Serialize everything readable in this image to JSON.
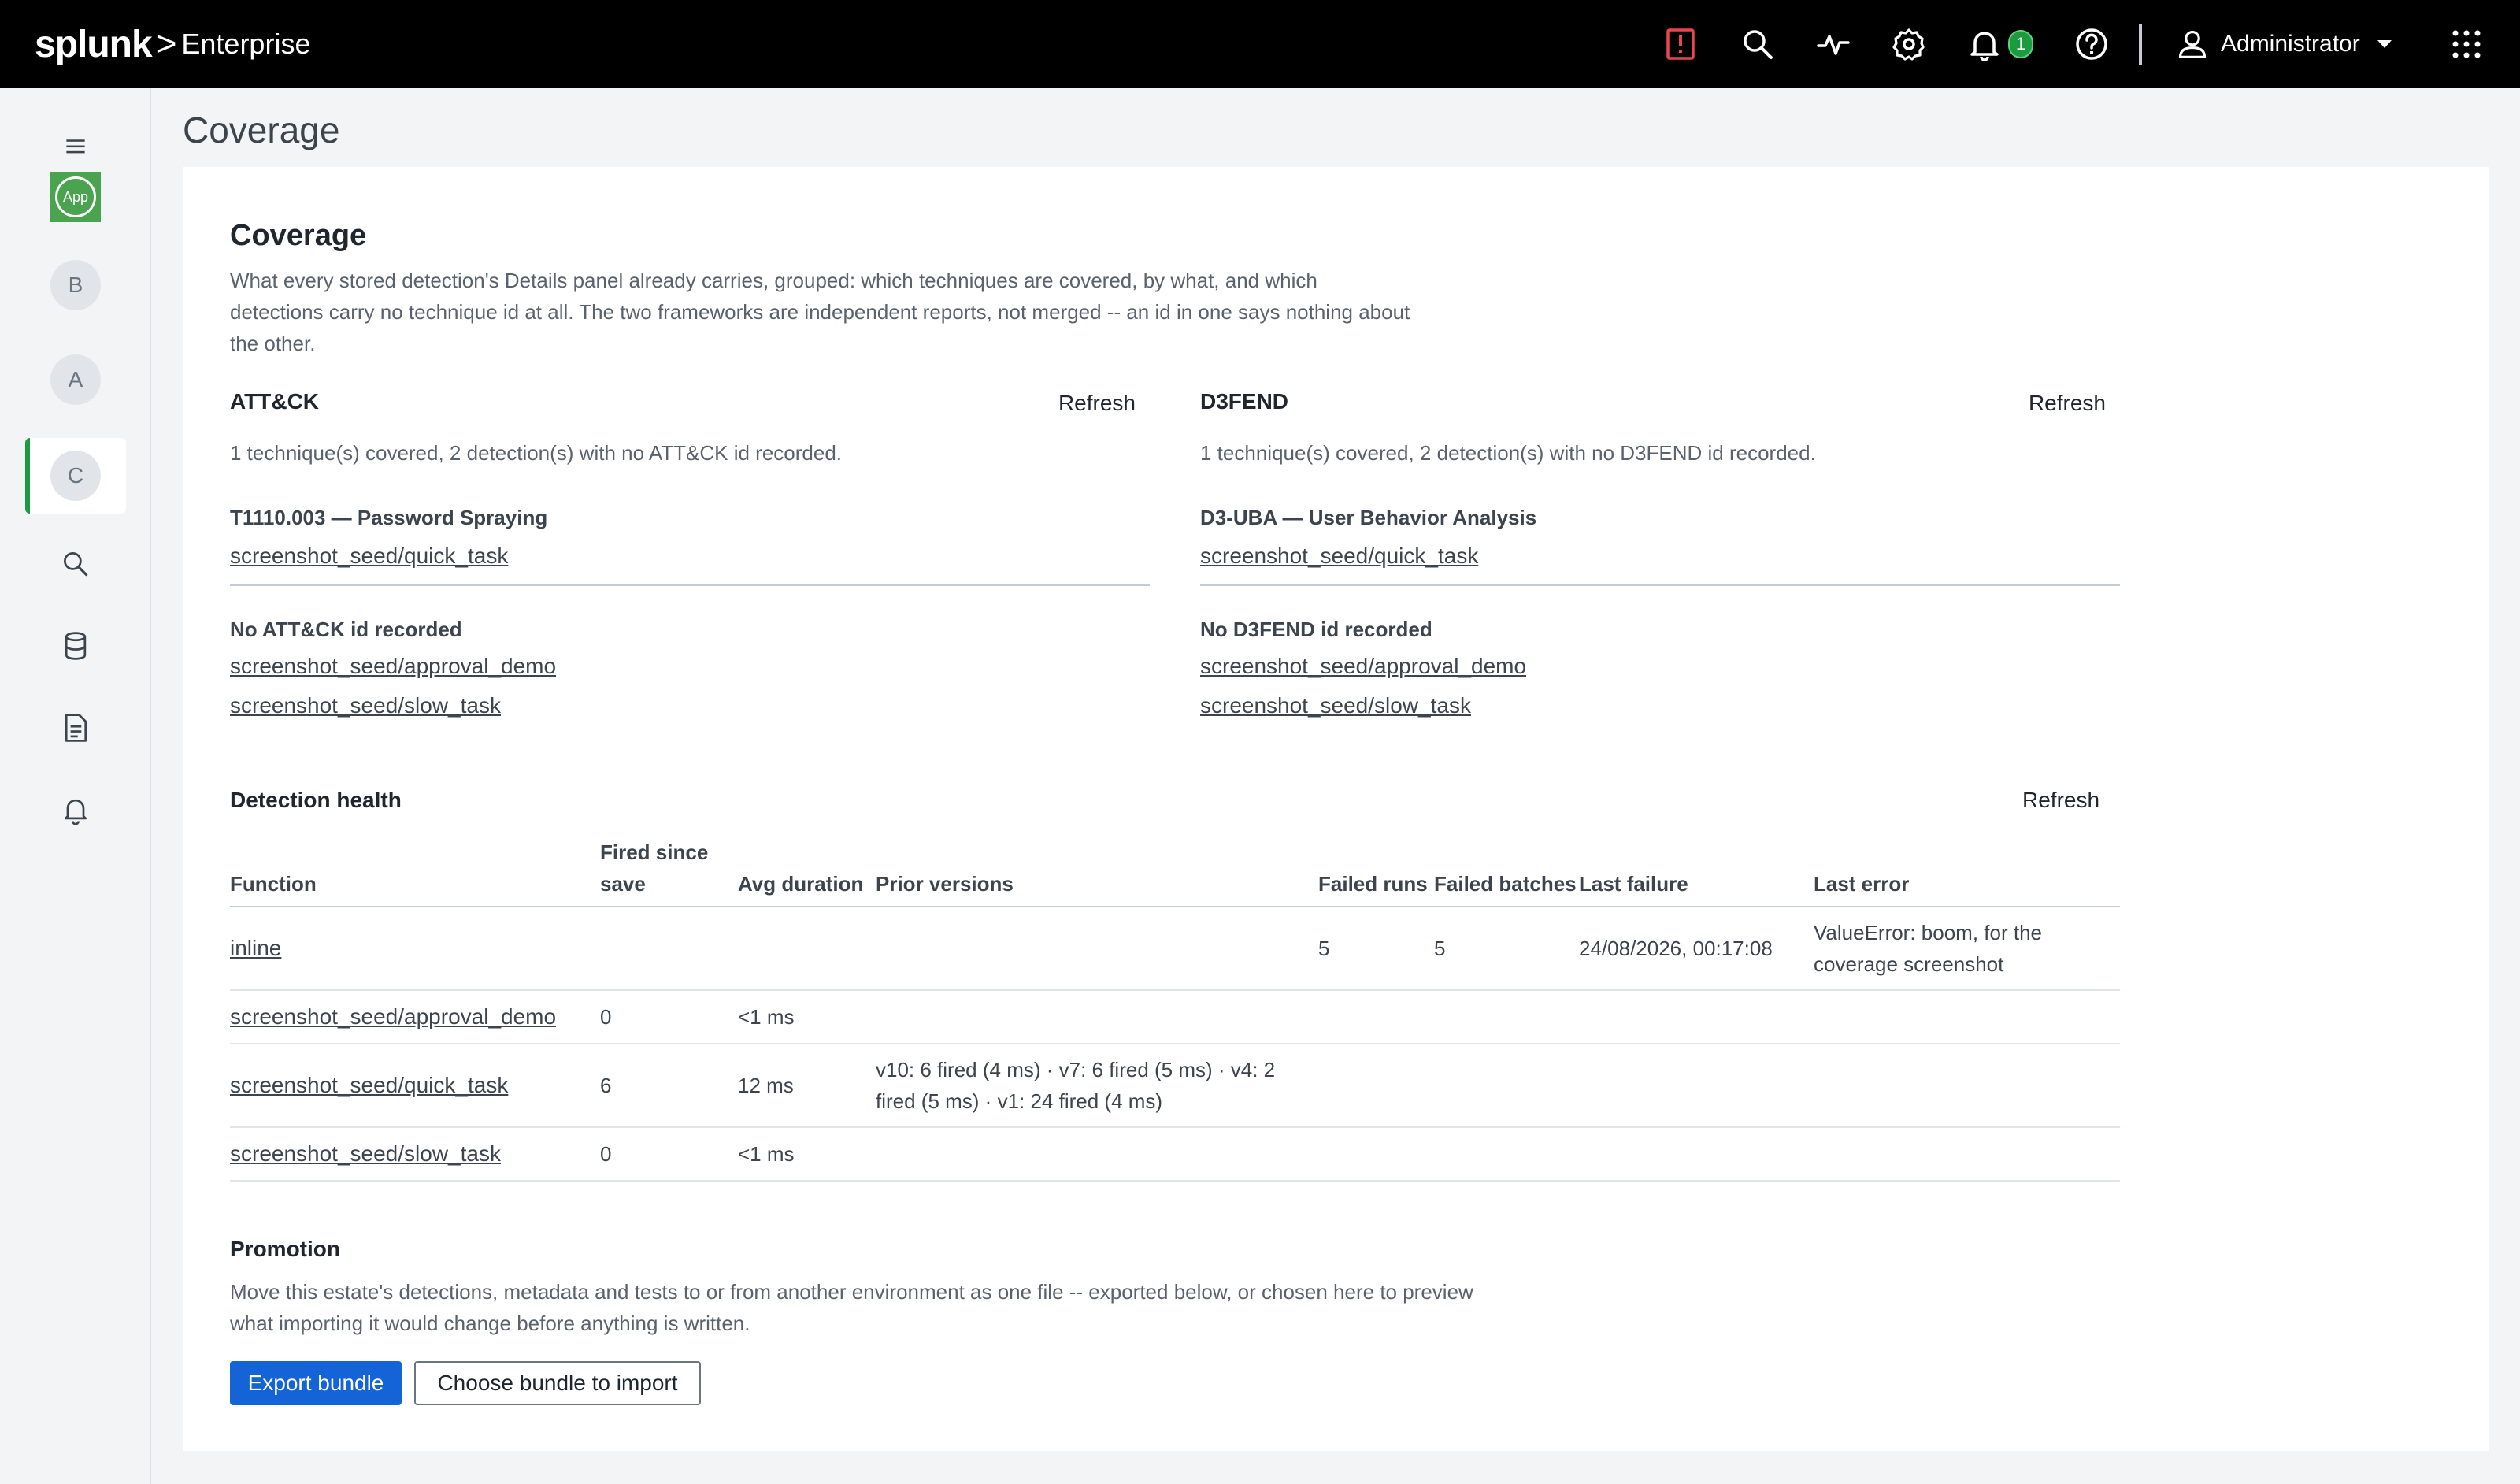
{
  "brand": {
    "logo": "splunk",
    "separator": ">",
    "product": "Enterprise"
  },
  "topbar": {
    "icons": [
      "alert-icon",
      "search-icon",
      "activity-icon",
      "gear-icon",
      "bell-icon",
      "help-icon",
      "user-icon",
      "apps-grid-icon"
    ],
    "notification_count": "1",
    "user_name": "Administrator",
    "alert_color": "#e8474f",
    "badge_color": "#1a9c3e"
  },
  "sidebar": {
    "menu_icon": "menu-icon",
    "app_label": "App",
    "items": [
      {
        "label": "B",
        "active": false
      },
      {
        "label": "A",
        "active": false
      },
      {
        "label": "C",
        "active": true
      }
    ],
    "tool_icons": [
      "search-icon",
      "database-icon",
      "document-icon",
      "bell-icon"
    ],
    "accent_color": "#1a9c3e"
  },
  "page": {
    "title": "Coverage"
  },
  "coverage": {
    "heading": "Coverage",
    "intro": "What every stored detection's Details panel already carries, grouped: which techniques are covered, by what, and which detections carry no technique id at all. The two frameworks are independent reports, not merged -- an id in one says nothing about the other.",
    "attack": {
      "title": "ATT&CK",
      "refresh": "Refresh",
      "summary": "1 technique(s) covered, 2 detection(s) with no ATT&CK id recorded.",
      "technique": "T1110.003 — Password Spraying",
      "technique_links": [
        "screenshot_seed/quick_task"
      ],
      "none_title": "No ATT&CK id recorded",
      "none_links": [
        "screenshot_seed/approval_demo",
        "screenshot_seed/slow_task"
      ]
    },
    "d3fend": {
      "title": "D3FEND",
      "refresh": "Refresh",
      "summary": "1 technique(s) covered, 2 detection(s) with no D3FEND id recorded.",
      "technique": "D3-UBA — User Behavior Analysis",
      "technique_links": [
        "screenshot_seed/quick_task"
      ],
      "none_title": "No D3FEND id recorded",
      "none_links": [
        "screenshot_seed/approval_demo",
        "screenshot_seed/slow_task"
      ]
    }
  },
  "health": {
    "title": "Detection health",
    "refresh": "Refresh",
    "columns": [
      "Function",
      "Fired since save",
      "Avg duration",
      "Prior versions",
      "Failed runs",
      "Failed batches",
      "Last failure",
      "Last error"
    ],
    "rows": [
      {
        "function": "inline",
        "fired": "",
        "avg": "",
        "prior": "",
        "failed_runs": "5",
        "failed_batches": "5",
        "last_failure": "24/08/2026, 00:17:08",
        "last_error": "ValueError: boom, for the coverage screenshot"
      },
      {
        "function": "screenshot_seed/approval_demo",
        "fired": "0",
        "avg": "<1 ms",
        "prior": "",
        "failed_runs": "",
        "failed_batches": "",
        "last_failure": "",
        "last_error": ""
      },
      {
        "function": "screenshot_seed/quick_task",
        "fired": "6",
        "avg": "12 ms",
        "prior": "v10: 6 fired (4 ms) · v7: 6 fired (5 ms) · v4: 2 fired (5 ms) · v1: 24 fired (4 ms)",
        "failed_runs": "",
        "failed_batches": "",
        "last_failure": "",
        "last_error": ""
      },
      {
        "function": "screenshot_seed/slow_task",
        "fired": "0",
        "avg": "<1 ms",
        "prior": "",
        "failed_runs": "",
        "failed_batches": "",
        "last_failure": "",
        "last_error": ""
      }
    ]
  },
  "promotion": {
    "title": "Promotion",
    "text": "Move this estate's detections, metadata and tests to or from another environment as one file -- exported below, or chosen here to preview what importing it would change before anything is written.",
    "export_label": "Export bundle",
    "import_label": "Choose bundle to import",
    "primary_color": "#1464d7"
  }
}
